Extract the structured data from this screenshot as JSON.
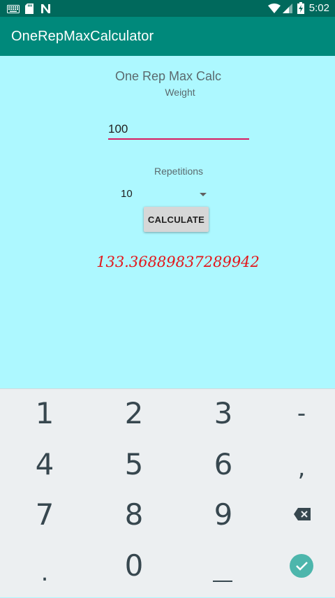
{
  "status_bar": {
    "time": "5:02",
    "icons": [
      "keyboard-icon",
      "sd-card-icon",
      "n-notification-icon",
      "wifi-icon",
      "cell-signal-icon",
      "battery-charging-icon"
    ]
  },
  "app_bar": {
    "title": "OneRepMaxCalculator"
  },
  "form": {
    "heading": "One Rep Max Calc",
    "weight_label": "Weight",
    "weight_value": "100",
    "reps_label": "Repetitions",
    "reps_value": "10",
    "button_label": "CALCULATE",
    "result": "133.36889837289942"
  },
  "keyboard": {
    "keys": [
      "1",
      "2",
      "3",
      "-",
      "4",
      "5",
      "6",
      ",",
      "7",
      "8",
      "9",
      ".",
      "0"
    ],
    "special_icons": [
      "backspace-icon",
      "enter-check-icon",
      "space-bar-icon"
    ]
  },
  "colors": {
    "status_bar": "#00695c",
    "app_bar": "#00897b",
    "background": "#adf8ff",
    "input_underline": "#d81b60",
    "result_text": "#e3171b",
    "keyboard_bg": "#eceff1",
    "enter_key": "#4db6ac"
  }
}
